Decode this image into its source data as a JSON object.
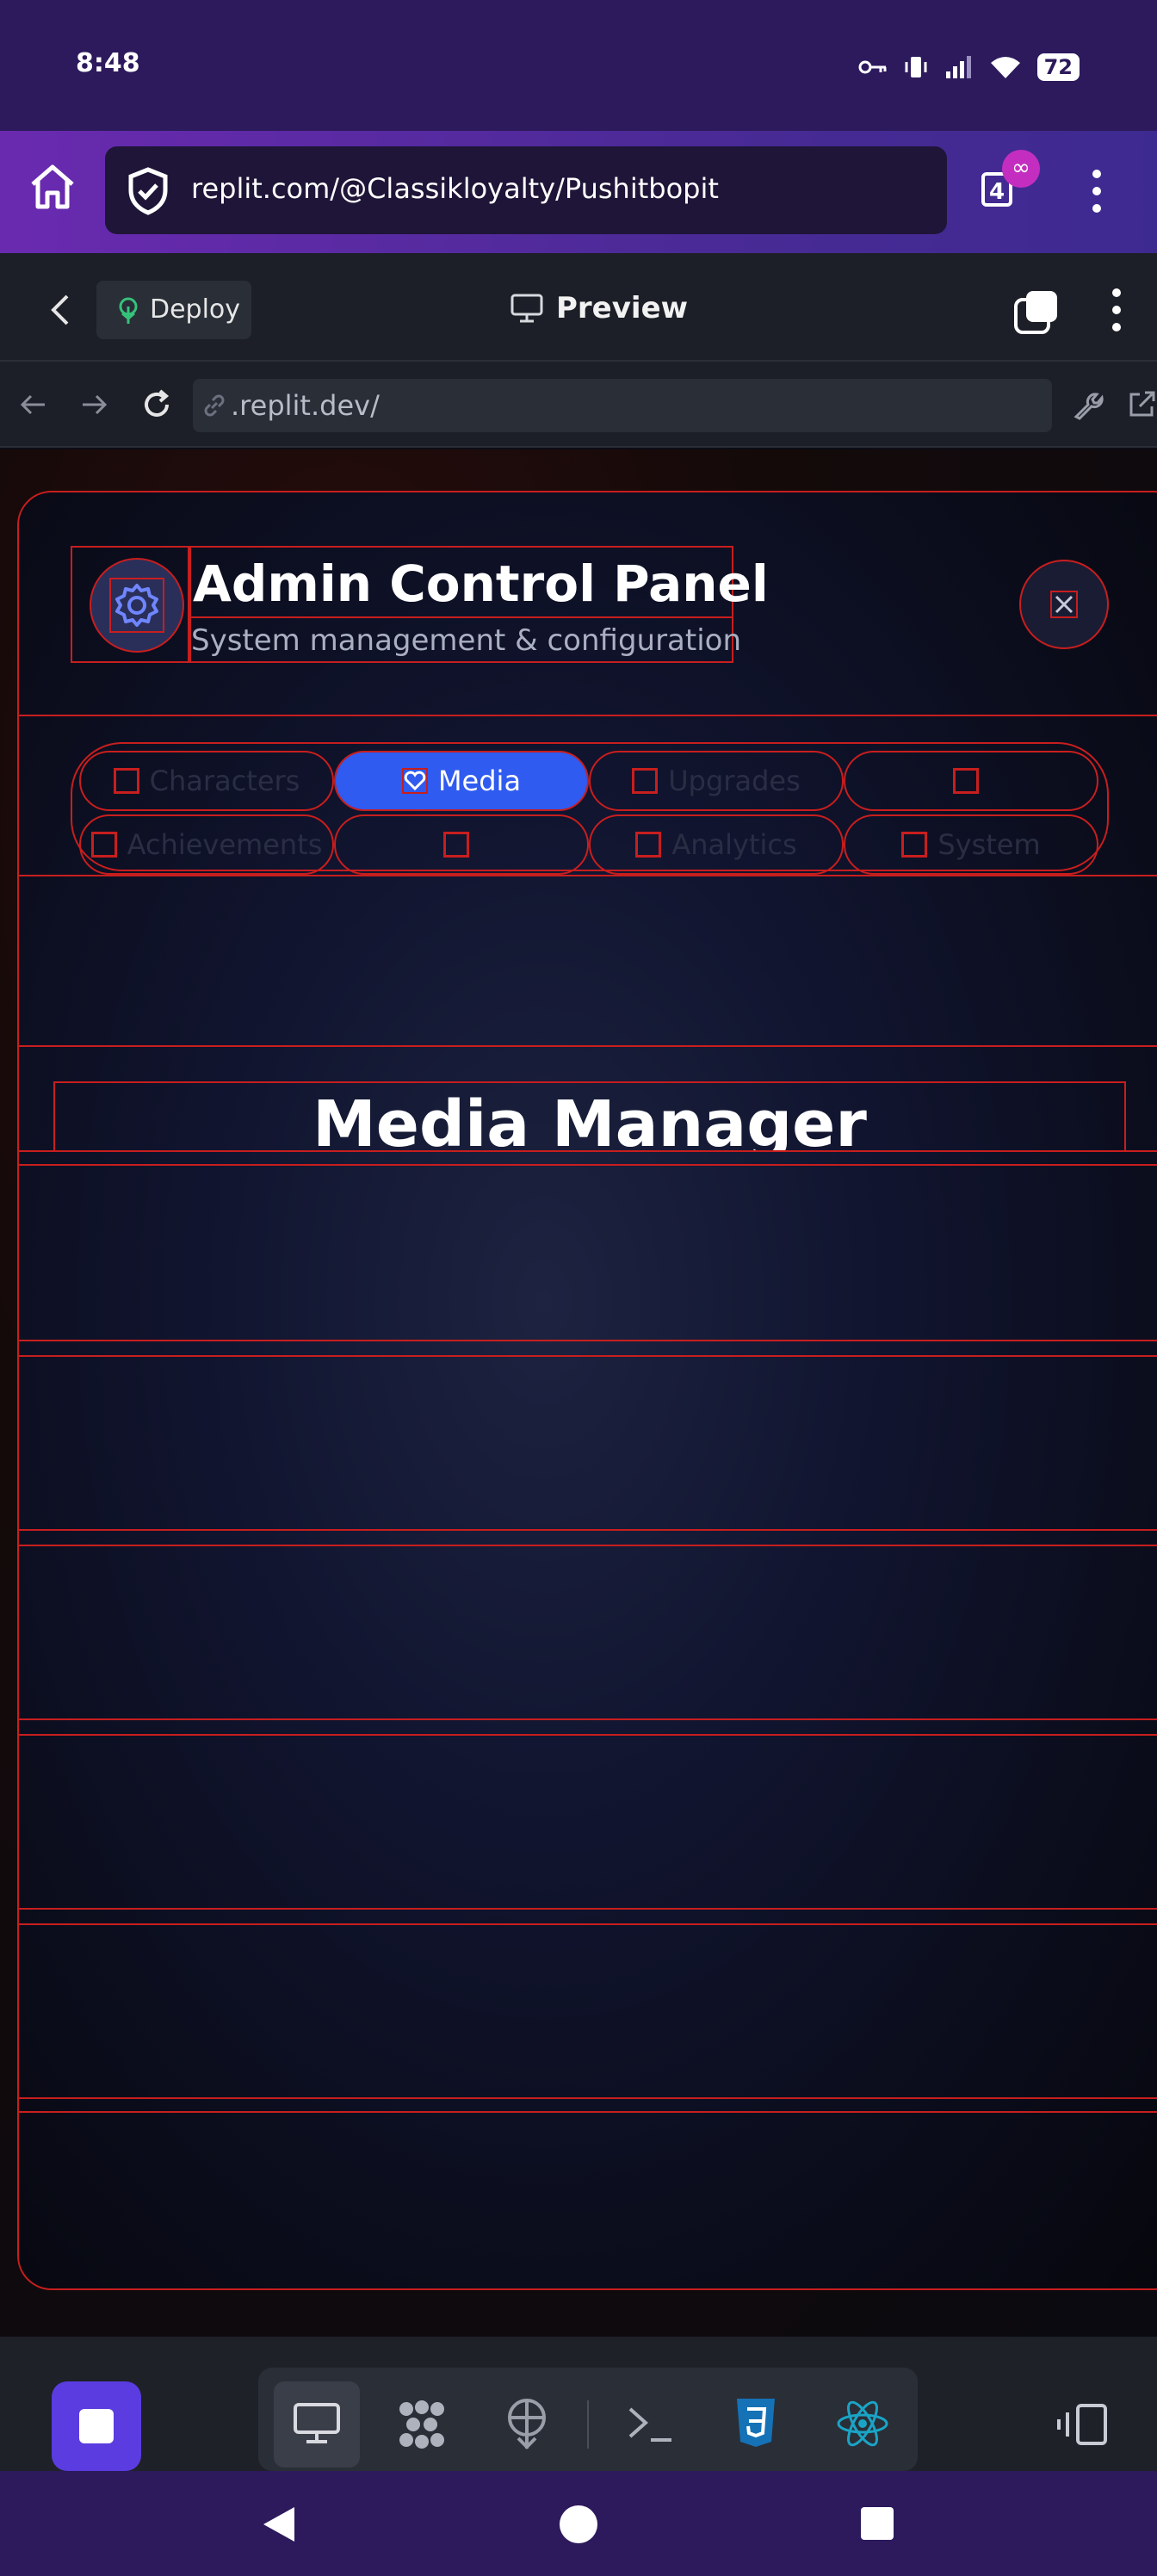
{
  "status_bar": {
    "time": "8:48",
    "battery": "72"
  },
  "browser": {
    "url": "replit.com/@Classikloyalty/Pushitbopit",
    "tab_count": "4",
    "tab_badge": "∞"
  },
  "replit_header": {
    "deploy_label": "Deploy",
    "preview_label": "Preview"
  },
  "nav": {
    "address": ".replit.dev/"
  },
  "panel": {
    "title": "Admin Control Panel",
    "subtitle": "System management & configuration",
    "tabs": [
      {
        "label": "Characters",
        "active": false
      },
      {
        "label": "Media",
        "active": true
      },
      {
        "label": "Upgrades",
        "active": false
      },
      {
        "label": "",
        "active": false
      },
      {
        "label": "Achievements",
        "active": false
      },
      {
        "label": "",
        "active": false
      },
      {
        "label": "Analytics",
        "active": false
      },
      {
        "label": "System",
        "active": false
      }
    ],
    "section_title": "Media Manager"
  },
  "colors": {
    "accent": "#2f5bf0",
    "debug_outline": "#c81e1e",
    "stop_button": "#5a3ce0",
    "status_bar": "#2c1a5c"
  }
}
